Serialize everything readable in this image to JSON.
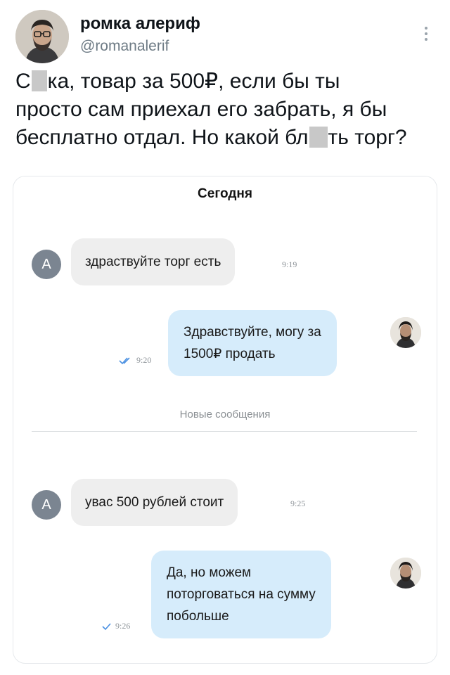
{
  "tweet": {
    "author": {
      "display_name": "ромка алериф",
      "handle": "@romanalerif"
    },
    "more_icon": "more-vertical-icon",
    "text_lines": [
      {
        "parts": [
          "С",
          "ка, товар за 500₽, если бы ты"
        ]
      },
      {
        "parts": [
          "просто сам приехал его забрать, я бы"
        ]
      },
      {
        "parts": [
          "бесплатно отдал. Но какой бл",
          "ть торг?"
        ]
      }
    ]
  },
  "chat": {
    "date_label": "Сегодня",
    "new_messages_label": "Новые сообщения",
    "messages": [
      {
        "direction": "incoming",
        "avatar_letter": "А",
        "lines": [
          "здраствуйте торг есть"
        ],
        "time": "9:19"
      },
      {
        "direction": "outgoing",
        "lines": [
          "Здравствуйте, могу за",
          "1500₽ продать"
        ],
        "time": "9:20",
        "status": "read"
      },
      {
        "direction": "incoming",
        "avatar_letter": "А",
        "lines": [
          "увас 500 рублей стоит"
        ],
        "time": "9:25"
      },
      {
        "direction": "outgoing",
        "lines": [
          "Да, но можем",
          "поторговаться на сумму",
          "побольше"
        ],
        "time": "9:26",
        "status": "sent"
      }
    ]
  },
  "colors": {
    "incoming_bubble": "#eeeeee",
    "outgoing_bubble": "#d6ecfb",
    "check_blue": "#4a90e2",
    "letter_avatar": "#7b8591"
  }
}
